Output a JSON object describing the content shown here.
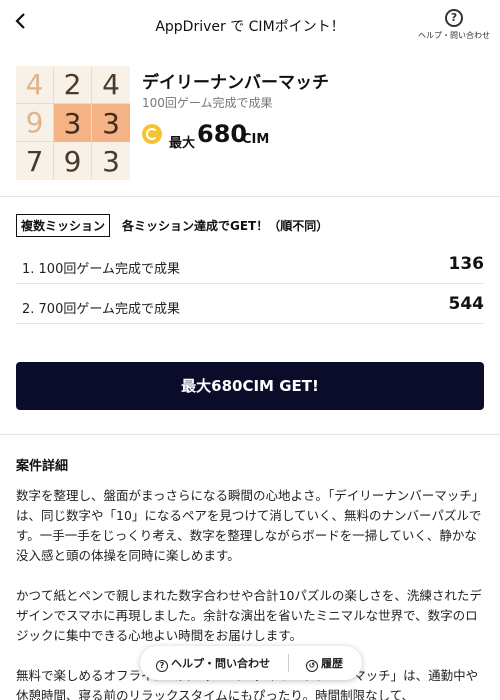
{
  "header": {
    "title": "AppDriver で CIMポイント！",
    "help_label": "ヘルプ・問い合わせ",
    "help_icon": "question-circle-icon",
    "back_icon": "chevron-left-icon"
  },
  "offer": {
    "grid": [
      "4",
      "2",
      "4",
      "9",
      "3",
      "3",
      "7",
      "9",
      "3"
    ],
    "title": "デイリーナンバーマッチ",
    "subtitle": "100回ゲーム完成で成果",
    "reward_prefix": "最大",
    "reward_value": "680",
    "reward_unit": "CIM",
    "coin_icon": "cim-coin-icon",
    "coin_color": "#f5c233"
  },
  "missions": {
    "badge": "複数ミッション",
    "note": "各ミッション達成でGET！（順不同）",
    "items": [
      {
        "label": "1. 100回ゲーム完成で成果",
        "points": "136"
      },
      {
        "label": "2. 700回ゲーム完成で成果",
        "points": "544"
      }
    ]
  },
  "cta": {
    "label": "最大680CIM GET!",
    "color": "#0b0b2a"
  },
  "details": {
    "title": "案件詳細",
    "paragraphs": [
      "数字を整理し、盤面がまっさらになる瞬間の心地よさ。「デイリーナンバーマッチ」は、同じ数字や「10」になるペアを見つけて消していく、無料のナンバーパズルです。一手一手をじっくり考え、数字を整理しながらボードを一掃していく、静かな没入感と頭の体操を同時に楽しめます。",
      "かつて紙とペンで親しまれた数字合わせや合計10パズルの楽しさを、洗練されたデザインでスマホに再現しました。余計な演出を省いたミニマルな世界で、数字のロジックに集中できる心地よい時間をお届けします。",
      "無料で楽しめるオフラインパズルゲーム「デイリーナンバーマッチ」は、通勤中や休憩時間、寝る前のリラックスタイムにもぴったり。時間制限なして、"
    ]
  },
  "bottom_bar": {
    "help_label": "ヘルプ・問い合わせ",
    "history_label": "履歴"
  }
}
